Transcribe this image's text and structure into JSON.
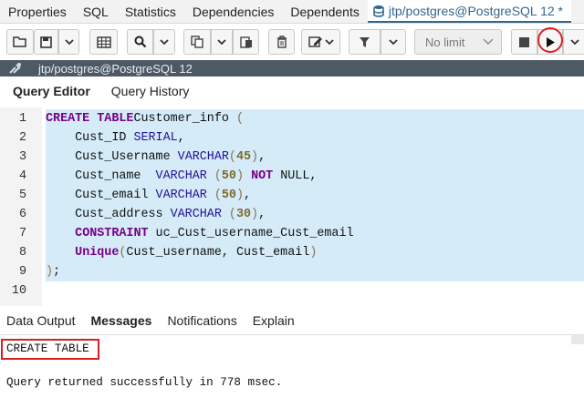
{
  "top_tabs": [
    {
      "label": "Properties"
    },
    {
      "label": "SQL"
    },
    {
      "label": "Statistics"
    },
    {
      "label": "Dependencies"
    },
    {
      "label": "Dependents"
    }
  ],
  "active_tab": {
    "label": "jtp/postgres@PostgreSQL 12 *"
  },
  "toolbar": {
    "limit_label": "No limit"
  },
  "connection": {
    "label": "jtp/postgres@PostgreSQL 12"
  },
  "editor_tabs": [
    {
      "label": "Query Editor"
    },
    {
      "label": "Query History"
    }
  ],
  "code_lines": [
    {
      "num": "1",
      "tokens": [
        [
          "kw",
          "CREATE TABLE"
        ],
        [
          "",
          "Customer_info "
        ],
        [
          "pn",
          "("
        ]
      ]
    },
    {
      "num": "2",
      "tokens": [
        [
          "",
          "    Cust_ID "
        ],
        [
          "ty",
          "SERIAL"
        ],
        [
          "",
          ","
        ]
      ]
    },
    {
      "num": "3",
      "tokens": [
        [
          "",
          "    Cust_Username "
        ],
        [
          "ty",
          "VARCHAR"
        ],
        [
          "pn",
          "("
        ],
        [
          "nm",
          "45"
        ],
        [
          "pn",
          ")"
        ],
        [
          "",
          ","
        ]
      ]
    },
    {
      "num": "4",
      "tokens": [
        [
          "",
          "    Cust_name  "
        ],
        [
          "ty",
          "VARCHAR"
        ],
        [
          "",
          " "
        ],
        [
          "pn",
          "("
        ],
        [
          "nm",
          "50"
        ],
        [
          "pn",
          ")"
        ],
        [
          "",
          " "
        ],
        [
          "kw",
          "NOT"
        ],
        [
          "",
          " NULL,"
        ]
      ]
    },
    {
      "num": "5",
      "tokens": [
        [
          "",
          "    Cust_email "
        ],
        [
          "ty",
          "VARCHAR"
        ],
        [
          "",
          " "
        ],
        [
          "pn",
          "("
        ],
        [
          "nm",
          "50"
        ],
        [
          "pn",
          ")"
        ],
        [
          "",
          ","
        ]
      ]
    },
    {
      "num": "6",
      "tokens": [
        [
          "",
          "    Cust_address "
        ],
        [
          "ty",
          "VARCHAR"
        ],
        [
          "",
          " "
        ],
        [
          "pn",
          "("
        ],
        [
          "nm",
          "30"
        ],
        [
          "pn",
          ")"
        ],
        [
          "",
          ","
        ]
      ]
    },
    {
      "num": "7",
      "tokens": [
        [
          "",
          "    "
        ],
        [
          "kw",
          "CONSTRAINT"
        ],
        [
          "",
          " uc_Cust_username_Cust_email"
        ]
      ]
    },
    {
      "num": "8",
      "tokens": [
        [
          "",
          "    "
        ],
        [
          "kw",
          "Unique"
        ],
        [
          "pn",
          "("
        ],
        [
          "",
          "Cust_username, Cust_email"
        ],
        [
          "pn",
          ")"
        ]
      ]
    },
    {
      "num": "9",
      "tokens": [
        [
          "pn",
          ")"
        ],
        [
          "",
          ";"
        ]
      ]
    },
    {
      "num": "10",
      "tokens": []
    }
  ],
  "result_tabs": [
    {
      "label": "Data Output"
    },
    {
      "label": "Messages"
    },
    {
      "label": "Notifications"
    },
    {
      "label": "Explain"
    }
  ],
  "messages": {
    "line1": "CREATE TABLE",
    "line2": "Query returned successfully in 778 msec."
  },
  "colors": {
    "accent": "#326690",
    "selection": "#d5ecf8",
    "highlight_red": "#d62020",
    "connection_bar": "#4d5a66"
  }
}
